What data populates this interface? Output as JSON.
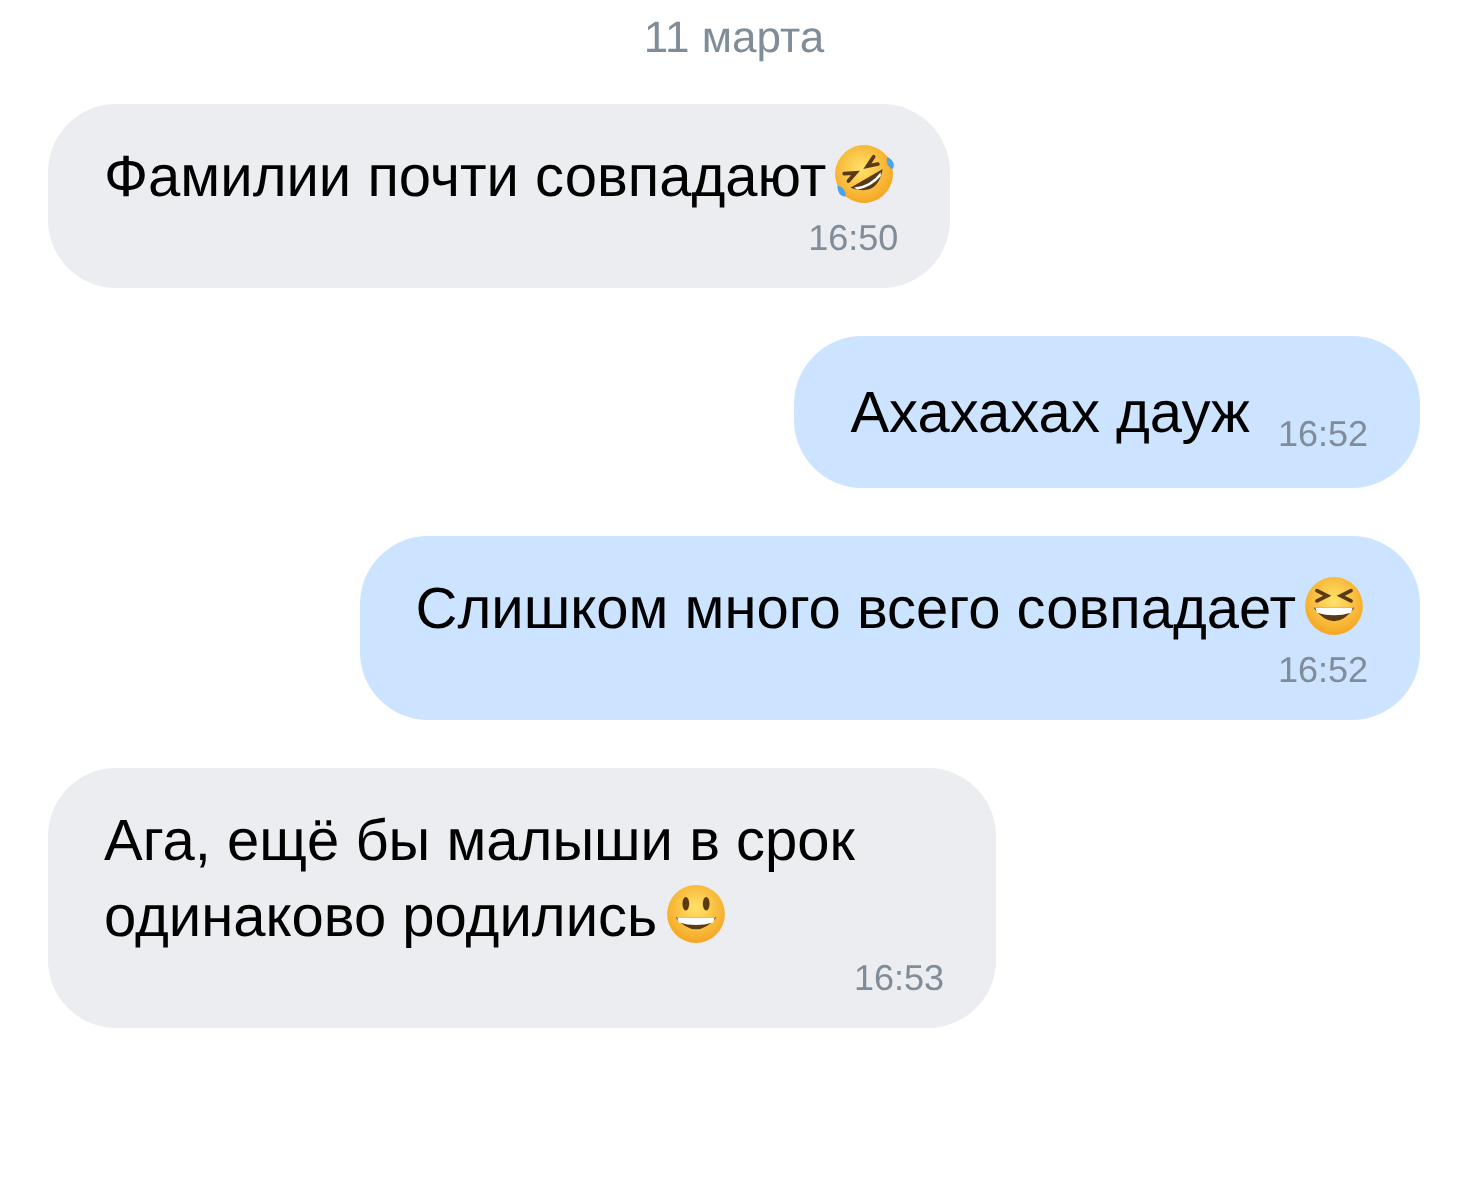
{
  "date": "11 марта",
  "messages": [
    {
      "kind": "incoming",
      "text": "Фамилии почти совпадают",
      "emoji": {
        "kind": "rofl"
      },
      "time": "16:50",
      "time_inline": false
    },
    {
      "kind": "outgoing",
      "text": "Ахахахах дауж",
      "time": "16:52",
      "time_inline": true
    },
    {
      "kind": "outgoing",
      "text": "Слишком много всего совпадает",
      "emoji": {
        "kind": "squint"
      },
      "time": "16:52",
      "time_inline": false
    },
    {
      "kind": "incoming",
      "text": "Ага, ещё бы малыши в срок одинаково родились",
      "emoji": {
        "kind": "smile"
      },
      "time": "16:53",
      "time_inline": false
    }
  ]
}
